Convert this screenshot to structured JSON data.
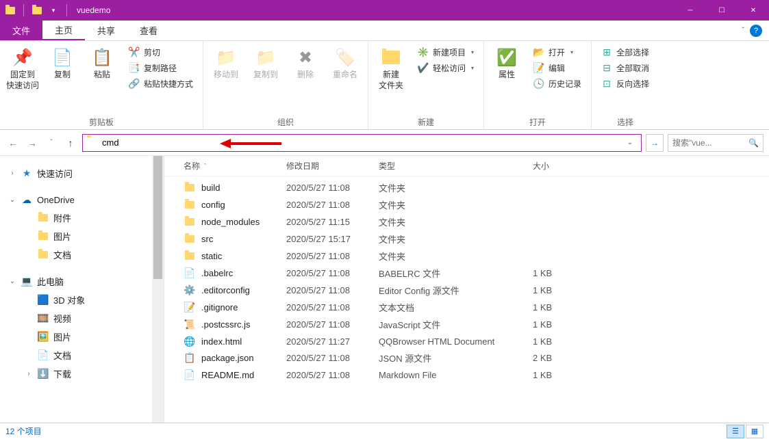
{
  "window": {
    "title": "vuedemo"
  },
  "tabs": {
    "file": "文件",
    "home": "主页",
    "share": "共享",
    "view": "查看"
  },
  "ribbon": {
    "clipboard": {
      "label": "剪贴板",
      "pin": "固定到\n快速访问",
      "copy": "复制",
      "paste": "粘贴",
      "cut": "剪切",
      "copypath": "复制路径",
      "pasteshortcut": "粘贴快捷方式"
    },
    "organize": {
      "label": "组织",
      "moveto": "移动到",
      "copyto": "复制到",
      "delete": "删除",
      "rename": "重命名"
    },
    "new": {
      "label": "新建",
      "newfolder": "新建\n文件夹",
      "newitem": "新建项目",
      "easyaccess": "轻松访问"
    },
    "open": {
      "label": "打开",
      "properties": "属性",
      "open": "打开",
      "edit": "编辑",
      "history": "历史记录"
    },
    "select": {
      "label": "选择",
      "selectall": "全部选择",
      "selectnone": "全部取消",
      "invert": "反向选择"
    }
  },
  "address": {
    "value": "cmd"
  },
  "search": {
    "placeholder": "搜索\"vue..."
  },
  "sidebar": {
    "quickaccess": "快速访问",
    "onedrive": "OneDrive",
    "onedrive_children": [
      "附件",
      "图片",
      "文档"
    ],
    "thispc": "此电脑",
    "thispc_children": [
      "3D 对象",
      "视频",
      "图片",
      "文档",
      "下载"
    ]
  },
  "columns": {
    "name": "名称",
    "date": "修改日期",
    "type": "类型",
    "size": "大小"
  },
  "files": [
    {
      "icon": "folder",
      "name": "build",
      "date": "2020/5/27 11:08",
      "type": "文件夹",
      "size": ""
    },
    {
      "icon": "folder",
      "name": "config",
      "date": "2020/5/27 11:08",
      "type": "文件夹",
      "size": ""
    },
    {
      "icon": "folder",
      "name": "node_modules",
      "date": "2020/5/27 11:15",
      "type": "文件夹",
      "size": ""
    },
    {
      "icon": "folder",
      "name": "src",
      "date": "2020/5/27 15:17",
      "type": "文件夹",
      "size": ""
    },
    {
      "icon": "folder",
      "name": "static",
      "date": "2020/5/27 11:08",
      "type": "文件夹",
      "size": ""
    },
    {
      "icon": "file",
      "name": ".babelrc",
      "date": "2020/5/27 11:08",
      "type": "BABELRC 文件",
      "size": "1 KB"
    },
    {
      "icon": "gear",
      "name": ".editorconfig",
      "date": "2020/5/27 11:08",
      "type": "Editor Config 源文件",
      "size": "1 KB"
    },
    {
      "icon": "text",
      "name": ".gitignore",
      "date": "2020/5/27 11:08",
      "type": "文本文档",
      "size": "1 KB"
    },
    {
      "icon": "js",
      "name": ".postcssrc.js",
      "date": "2020/5/27 11:08",
      "type": "JavaScript 文件",
      "size": "1 KB"
    },
    {
      "icon": "html",
      "name": "index.html",
      "date": "2020/5/27 11:27",
      "type": "QQBrowser HTML Document",
      "size": "1 KB"
    },
    {
      "icon": "json",
      "name": "package.json",
      "date": "2020/5/27 11:08",
      "type": "JSON 源文件",
      "size": "2 KB"
    },
    {
      "icon": "md",
      "name": "README.md",
      "date": "2020/5/27 11:08",
      "type": "Markdown File",
      "size": "1 KB"
    }
  ],
  "status": {
    "count": "12 个项目"
  }
}
